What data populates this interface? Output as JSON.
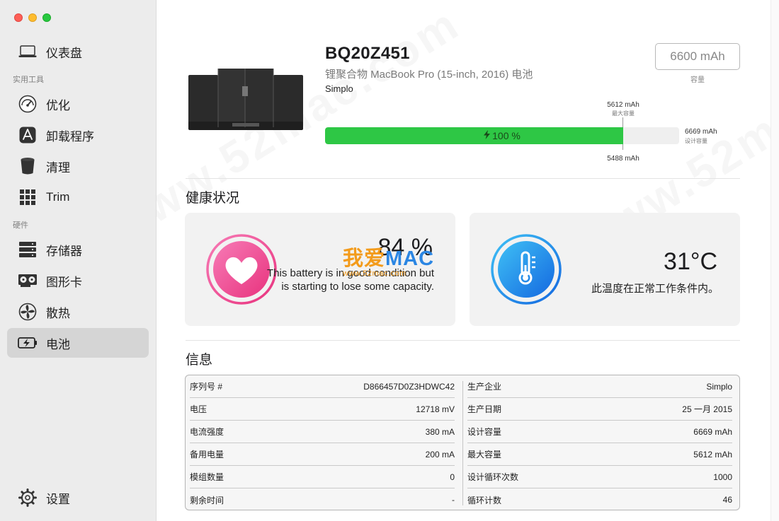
{
  "sidebar": {
    "dashboard": "仪表盘",
    "section_tools": "实用工具",
    "optimize": "优化",
    "uninstall": "卸载程序",
    "clean": "清理",
    "trim": "Trim",
    "section_hardware": "硬件",
    "storage": "存储器",
    "graphics": "图形卡",
    "cooling": "散热",
    "battery": "电池",
    "settings": "设置"
  },
  "battery": {
    "model": "BQ20Z451",
    "subtitle": "锂聚合物 MacBook Pro (15-inch, 2016) 电池",
    "manufacturer": "Simplo",
    "capacity_value": "6600 mAh",
    "capacity_label": "容量",
    "max_value": "5612 mAh",
    "max_label": "最大容量",
    "design_value": "6669 mAh",
    "design_label": "设计容量",
    "min_value": "5488 mAh",
    "charge_text": "100 %",
    "charge_fraction": 1.0,
    "max_fraction": 0.841
  },
  "health": {
    "section_title": "健康状况",
    "percent": "84 %",
    "description": "This battery is in good condition but is starting to lose some capacity.",
    "temperature": "31°C",
    "temp_description": "此温度在正常工作条件内。"
  },
  "info": {
    "section_title": "信息",
    "left": [
      {
        "key": "序列号 #",
        "value": "D866457D0Z3HDWC42"
      },
      {
        "key": "电压",
        "value": "12718 mV"
      },
      {
        "key": "电流强度",
        "value": "380 mA"
      },
      {
        "key": "备用电量",
        "value": "200 mA"
      },
      {
        "key": "模组数量",
        "value": "0"
      },
      {
        "key": "剩余时间",
        "value": "-"
      }
    ],
    "right": [
      {
        "key": "生产企业",
        "value": "Simplo"
      },
      {
        "key": "生产日期",
        "value": "25 一月 2015"
      },
      {
        "key": "设计容量",
        "value": "6669 mAh"
      },
      {
        "key": "最大容量",
        "value": "5612 mAh"
      },
      {
        "key": "设计循环次数",
        "value": "1000"
      },
      {
        "key": "循环计数",
        "value": "46"
      }
    ]
  },
  "watermark": {
    "part_a": "我爱",
    "part_b": "MAC",
    "url": "www.52mac.com",
    "background": "www.52mac.com"
  },
  "colors": {
    "accent_green": "#2ec745",
    "sidebar_bg": "#ececec",
    "card_bg": "#f2f2f2",
    "heart_pink": "#f0519b",
    "thermo_blue": "#1a8cf0"
  }
}
